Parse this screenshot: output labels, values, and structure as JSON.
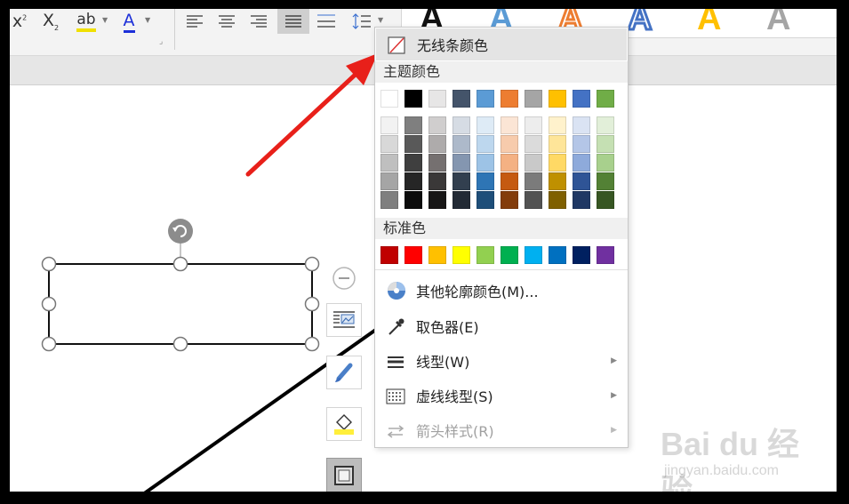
{
  "menu": {
    "no_line_color": "无线条颜色",
    "theme_colors_label": "主题颜色",
    "standard_colors_label": "标准色",
    "more_colors": "其他轮廓颜色(M)...",
    "eyedropper": "取色器(E)",
    "line_style": "线型(W)",
    "dash_style": "虚线线型(S)",
    "arrow_style": "箭头样式(R)"
  },
  "theme_row": [
    "#ffffff",
    "#000000",
    "#e7e6e6",
    "#44546a",
    "#5b9bd5",
    "#ed7d31",
    "#a5a5a5",
    "#ffc000",
    "#4472c4",
    "#70ad47"
  ],
  "theme_shades": [
    [
      "#f2f2f2",
      "#7f7f7f",
      "#d0cece",
      "#d6dce4",
      "#deebf6",
      "#fbe5d5",
      "#ededed",
      "#fff2cc",
      "#dae3f3",
      "#e2efd9"
    ],
    [
      "#d8d8d8",
      "#595959",
      "#aeabab",
      "#adb9ca",
      "#bdd7ee",
      "#f7cbac",
      "#dbdbdb",
      "#fee599",
      "#b4c6e7",
      "#c5e0b3"
    ],
    [
      "#bfbfbf",
      "#3f3f3f",
      "#757070",
      "#8496b0",
      "#9dc3e6",
      "#f4b183",
      "#c9c9c9",
      "#ffd965",
      "#8eaadb",
      "#a8d08d"
    ],
    [
      "#a5a5a5",
      "#262626",
      "#3a3838",
      "#323f4f",
      "#2e75b5",
      "#c55a11",
      "#7b7b7b",
      "#bf9000",
      "#2f5496",
      "#538135"
    ],
    [
      "#7f7f7f",
      "#0c0c0c",
      "#171616",
      "#222a35",
      "#1e4e79",
      "#833c0b",
      "#525252",
      "#7f6000",
      "#1f3864",
      "#375623"
    ]
  ],
  "standard_row": [
    "#c00000",
    "#ff0000",
    "#ffc000",
    "#ffff00",
    "#92d050",
    "#00b050",
    "#00b0f0",
    "#0070c0",
    "#002060",
    "#7030a0"
  ],
  "watermark": {
    "main": "Bai du 经验",
    "sub": "jingyan.baidu.com"
  },
  "colors": {
    "accent_red": "#e8201a",
    "menu_hover": "#e4e4e4"
  }
}
